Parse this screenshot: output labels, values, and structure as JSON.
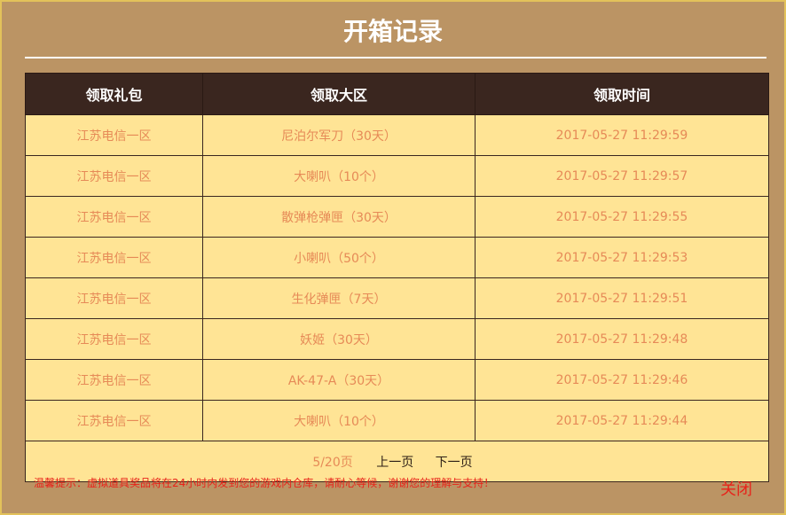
{
  "modal": {
    "title": "开箱记录",
    "close_label": "关闭",
    "tip": "温馨提示：虚拟道具奖品将在24小时内发到您的游戏内仓库，请耐心等候，谢谢您的理解与支持！"
  },
  "table": {
    "headers": [
      "领取礼包",
      "领取大区",
      "领取时间"
    ],
    "rows": [
      [
        "江苏电信一区",
        "尼泊尔军刀（30天）",
        "2017-05-27 11:29:59"
      ],
      [
        "江苏电信一区",
        "大喇叭（10个）",
        "2017-05-27 11:29:57"
      ],
      [
        "江苏电信一区",
        "散弹枪弹匣（30天）",
        "2017-05-27 11:29:55"
      ],
      [
        "江苏电信一区",
        "小喇叭（50个）",
        "2017-05-27 11:29:53"
      ],
      [
        "江苏电信一区",
        "生化弹匣（7天）",
        "2017-05-27 11:29:51"
      ],
      [
        "江苏电信一区",
        "妖姬（30天）",
        "2017-05-27 11:29:48"
      ],
      [
        "江苏电信一区",
        "AK-47-A（30天）",
        "2017-05-27 11:29:46"
      ],
      [
        "江苏电信一区",
        "大喇叭（10个）",
        "2017-05-27 11:29:44"
      ]
    ]
  },
  "pager": {
    "count": "5/20页",
    "prev_label": "上一页",
    "next_label": "下一页"
  },
  "colors": {
    "background": "#bb9464",
    "header_bg": "#3a261f",
    "row_bg": "#ffe495",
    "row_text": "#e68a57",
    "tip_text": "#e8231a"
  }
}
